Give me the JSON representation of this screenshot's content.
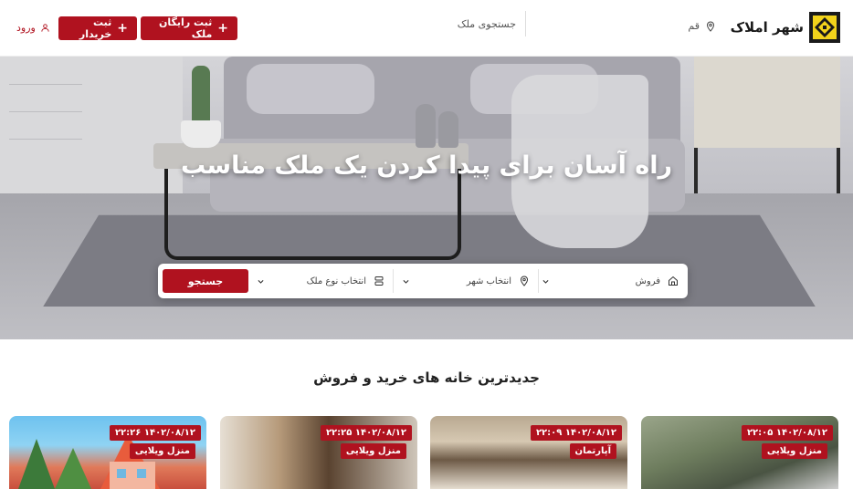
{
  "header": {
    "logo_text": "شهر املاک",
    "city": "قم",
    "search_placeholder": "جستجوی ملک",
    "free_listing_button": "ثبت رایگان ملک",
    "buyer_button": "ثبت خریدار",
    "login": "ورود"
  },
  "hero": {
    "title": "راه آسان برای پیدا کردن یک ملک مناسب",
    "search": {
      "deal_type": "فروش",
      "city": "انتخاب شهر",
      "property_type": "انتخاب نوع ملک",
      "submit": "جستجو"
    }
  },
  "listings": {
    "title": "جدیدترین خانه های خرید و فروش",
    "cards": [
      {
        "date": "۱۴۰۲/۰۸/۱۲ ۲۲:۰۵",
        "type": "منزل ویلایی"
      },
      {
        "date": "۱۴۰۲/۰۸/۱۲ ۲۲:۰۹",
        "type": "آپارتمان"
      },
      {
        "date": "۱۴۰۲/۰۸/۱۲ ۲۲:۲۵",
        "type": "منزل ویلایی"
      },
      {
        "date": "۱۴۰۲/۰۸/۱۲ ۲۲:۲۶",
        "type": "منزل ویلایی"
      }
    ]
  },
  "colors": {
    "accent": "#b0121f",
    "logo_yellow": "#f2d31b"
  },
  "icons": [
    "logo-icon",
    "location-pin-icon",
    "plus-icon",
    "user-icon",
    "home-icon",
    "chevron-down-icon",
    "building-icon"
  ]
}
